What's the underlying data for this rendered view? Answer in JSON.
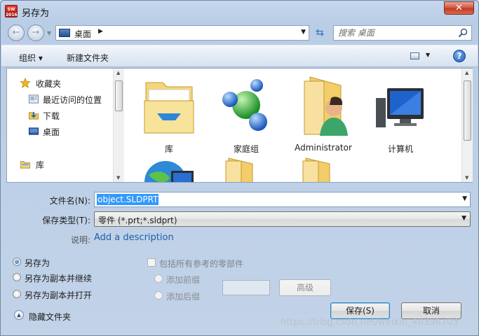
{
  "window": {
    "title": "另存为",
    "app_badge": "SW\n2016"
  },
  "address": {
    "location": "桌面",
    "search_placeholder": "搜索 桌面"
  },
  "toolbar": {
    "organize": "组织 ▾",
    "new_folder": "新建文件夹"
  },
  "nav_pane": {
    "items": [
      {
        "label": "收藏夹",
        "icon": "star-icon"
      },
      {
        "label": "最近访问的位置",
        "icon": "recent-places-icon"
      },
      {
        "label": "下载",
        "icon": "downloads-icon"
      },
      {
        "label": "桌面",
        "icon": "desktop-icon"
      },
      {
        "label": "库",
        "icon": "library-icon"
      }
    ]
  },
  "files": [
    {
      "label": "库",
      "icon": "library-folder-icon"
    },
    {
      "label": "家庭组",
      "icon": "homegroup-icon"
    },
    {
      "label": "Administrator",
      "icon": "user-folder-icon"
    },
    {
      "label": "计算机",
      "icon": "computer-icon"
    },
    {
      "label": "",
      "icon": "network-icon"
    },
    {
      "label": "",
      "icon": "folder-icon"
    },
    {
      "label": "",
      "icon": "folder-icon"
    }
  ],
  "form": {
    "filename_label": "文件名(N):",
    "filename_value": "object.SLDPRT",
    "filetype_label": "保存类型(T):",
    "filetype_value": "零件 (*.prt;*.sldprt)",
    "description_label": "说明:",
    "description_link": "Add a description"
  },
  "options": {
    "save_as": "另存为",
    "save_copy_continue": "另存为副本并继续",
    "save_copy_open": "另存为副本并打开",
    "include_refs": "包括所有参考的零部件",
    "add_prefix": "添加前缀",
    "add_suffix": "添加后缀",
    "advanced": "高级",
    "selected": "另存为"
  },
  "buttons": {
    "save": "保存(S)",
    "cancel": "取消",
    "hide_folders": "隐藏文件夹"
  },
  "watermark": "https://blog.csdn.net/weixin_40396703",
  "colors": {
    "accent": "#3399ff",
    "link": "#1e5fa8",
    "close": "#c23a22"
  }
}
